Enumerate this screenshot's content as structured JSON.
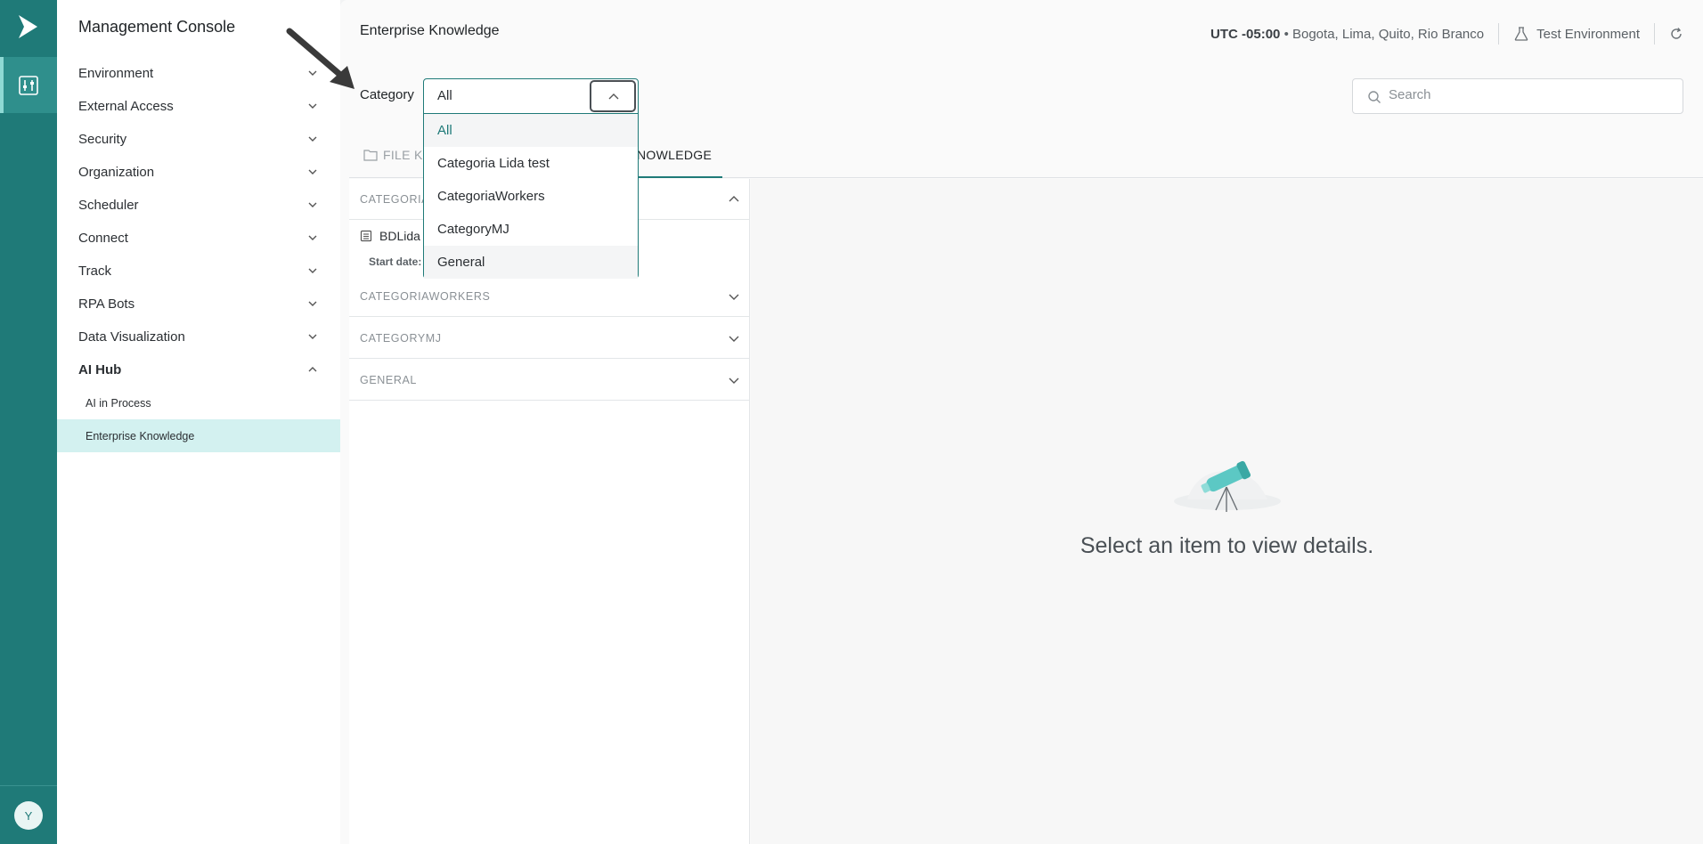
{
  "sidenav": {
    "title": "Management Console",
    "items": [
      {
        "label": "Environment"
      },
      {
        "label": "External Access"
      },
      {
        "label": "Security"
      },
      {
        "label": "Organization"
      },
      {
        "label": "Scheduler"
      },
      {
        "label": "Connect"
      },
      {
        "label": "Track"
      },
      {
        "label": "RPA Bots"
      },
      {
        "label": "Data Visualization"
      },
      {
        "label": "AI Hub"
      }
    ],
    "sub_items": [
      {
        "label": "AI in Process"
      },
      {
        "label": "Enterprise Knowledge"
      }
    ]
  },
  "user": {
    "avatar_initial": "Y"
  },
  "header": {
    "title": "Enterprise Knowledge",
    "timezone_offset": "UTC -05:00",
    "timezone_cities": "• Bogota, Lima, Quito, Rio Branco",
    "environment": "Test Environment"
  },
  "filter": {
    "label": "Category",
    "selected": "All",
    "options": [
      "All",
      "Categoria Lida test",
      "CategoriaWorkers",
      "CategoryMJ",
      "General"
    ]
  },
  "search": {
    "placeholder": "Search"
  },
  "tabs": {
    "file": "FILE K",
    "active": "NOWLEDGE"
  },
  "groups": {
    "first": "CATEGORIA",
    "item_name": "BDLida",
    "item_meta": "Start date:",
    "workers": "CATEGORIAWORKERS",
    "mj": "CATEGORYMJ",
    "general": "GENERAL"
  },
  "detail": {
    "empty_text": "Select an item to view details."
  },
  "colors": {
    "brand": "#1f7a78",
    "active_nav_bg": "#d3f1f0"
  }
}
